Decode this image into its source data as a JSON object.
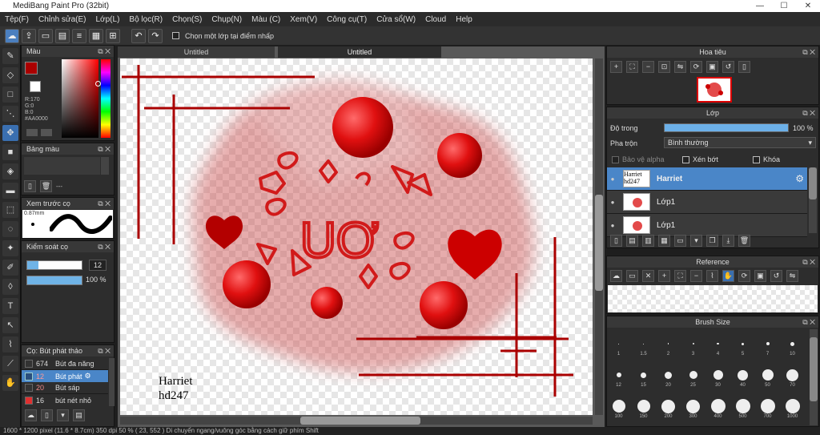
{
  "window": {
    "title": "MediBang Paint Pro (32bit)",
    "min": "—",
    "max": "☐",
    "close": "✕"
  },
  "menu": [
    "Tệp(F)",
    "Chỉnh sửa(E)",
    "Lớp(L)",
    "Bộ lọc(R)",
    "Chọn(S)",
    "Chụp(N)",
    "Màu (C)",
    "Xem(V)",
    "Công cụ(T)",
    "Cửa sổ(W)",
    "Cloud",
    "Help"
  ],
  "toolbar": {
    "select_layer_label": "Chọn một lớp tại điểm nhấp"
  },
  "color_panel": {
    "title": "Màu",
    "readout": [
      "R:170",
      "G:0",
      "B:0",
      "#AA0000"
    ],
    "main_color": "#AA0000",
    "sub_color": "#FFFFFF"
  },
  "palette_panel": {
    "title": "Bảng màu",
    "value": "---"
  },
  "preview_panel": {
    "title": "Xem trước cọ",
    "size": "0.87mm"
  },
  "control_panel": {
    "title": "Kiểm soát cọ",
    "size": "12",
    "opacity": "100 %"
  },
  "brush_panel": {
    "title": "Cọ: Bút phát thảo",
    "items": [
      {
        "size": "674",
        "name": "Bút đa năng"
      },
      {
        "size": "12",
        "name": "Bút phát"
      },
      {
        "size": "20",
        "name": "Bút sáp"
      },
      {
        "size": "16",
        "name": "bút nét nhỏ"
      }
    ]
  },
  "doc_tabs": [
    "Untitled",
    "Untitled"
  ],
  "canvas": {
    "signature_line1": "Harriet",
    "signature_line2": "hd247",
    "art_text": "UƠ"
  },
  "navigator": {
    "title": "Hoa tiêu"
  },
  "layer_panel": {
    "title": "Lớp",
    "opacity_label": "Độ trong",
    "opacity_value": "100 %",
    "opacity_fraction": 1.0,
    "blend_label": "Pha trộn",
    "blend_value": "Bình thường",
    "protect_alpha": "Bảo vệ alpha",
    "clipping": "Xén bớt",
    "lock": "Khóa",
    "layers": [
      {
        "name": "Harriet",
        "thumb": "Harriet hd247",
        "selected": true
      },
      {
        "name": "Lớp1",
        "selected": false
      },
      {
        "name": "Lớp1",
        "selected": false
      }
    ]
  },
  "reference_panel": {
    "title": "Reference"
  },
  "brushsize_panel": {
    "title": "Brush Size",
    "sizes": [
      "1",
      "1.5",
      "2",
      "3",
      "4",
      "5",
      "7",
      "10",
      "12",
      "15",
      "20",
      "25",
      "30",
      "40",
      "50",
      "70",
      "100",
      "150",
      "200",
      "300",
      "400",
      "500",
      "700",
      "1000"
    ]
  },
  "status": "1600 * 1200 pixel   (11.6 * 8.7cm)   350 dpi   50 %   ( 23, 552 )   Di chuyển ngang/vuông góc bằng cách giữ phím Shift"
}
